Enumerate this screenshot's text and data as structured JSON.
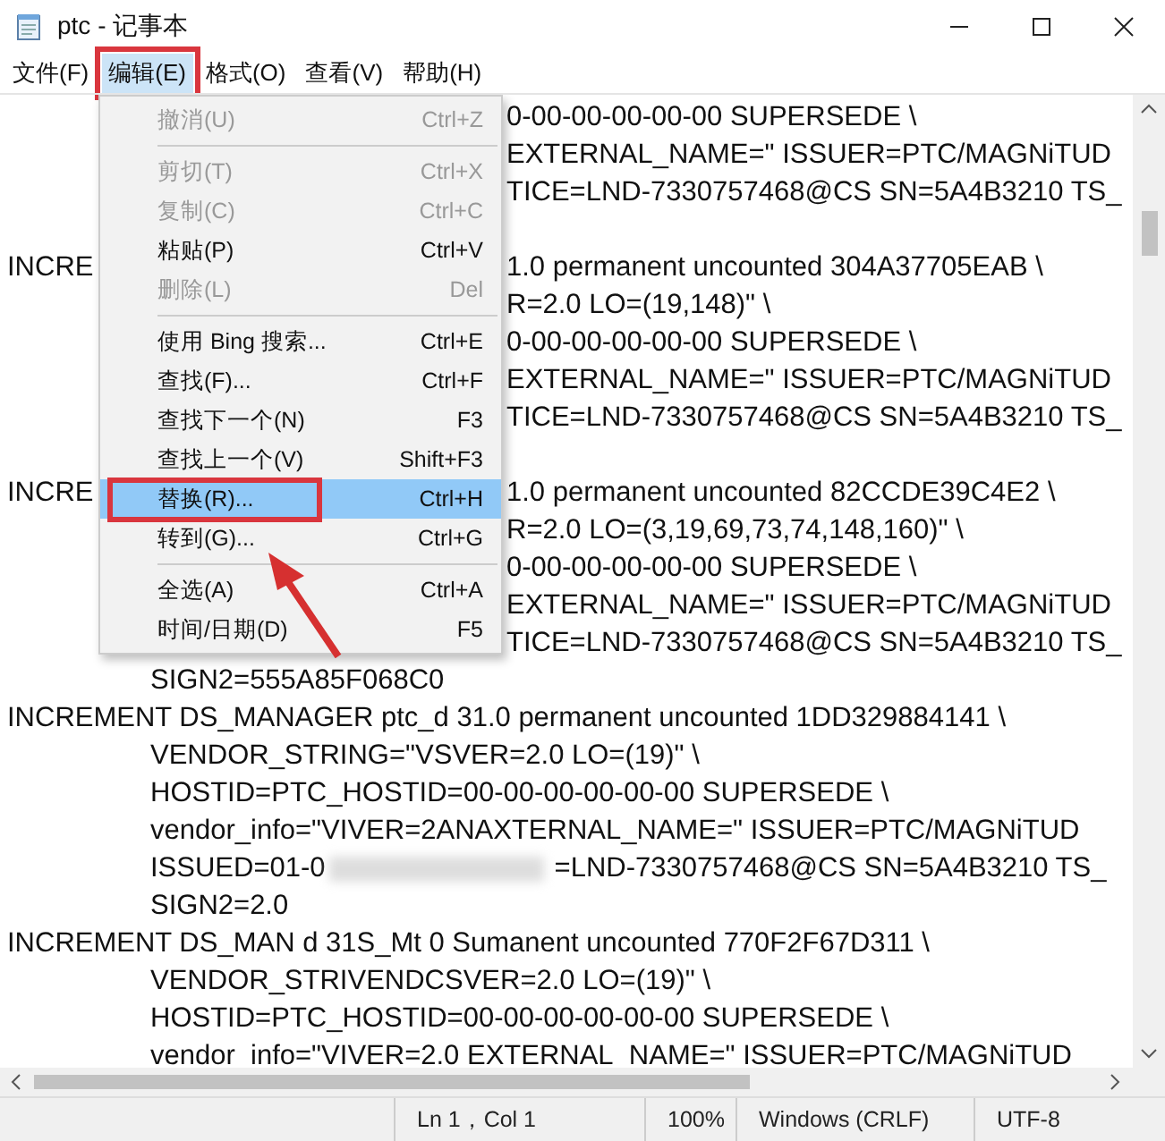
{
  "window": {
    "title": "ptc - 记事本"
  },
  "menubar": [
    {
      "label": "文件(F)",
      "selected": false,
      "highlighted": false
    },
    {
      "label": "编辑(E)",
      "selected": true,
      "highlighted": true
    },
    {
      "label": "格式(O)",
      "selected": false,
      "highlighted": false
    },
    {
      "label": "查看(V)",
      "selected": false,
      "highlighted": false
    },
    {
      "label": "帮助(H)",
      "selected": false,
      "highlighted": false
    }
  ],
  "lines": [
    {
      "kind": "cont",
      "tail": "0-00-00-00-00-00 SUPERSEDE \\"
    },
    {
      "kind": "cont",
      "tail": "EXTERNAL_NAME=\" ISSUER=PTC/MAGNiTUD"
    },
    {
      "kind": "cont",
      "tail": "TICE=LND-7330757468@CS SN=5A4B3210 TS_"
    },
    {
      "kind": "blank"
    },
    {
      "kind": "head",
      "lead": "INCRE",
      "tail": "1.0 permanent uncounted 304A37705EAB \\"
    },
    {
      "kind": "cont",
      "tail": "R=2.0 LO=(19,148)\" \\"
    },
    {
      "kind": "cont",
      "tail": "0-00-00-00-00-00 SUPERSEDE \\"
    },
    {
      "kind": "cont",
      "tail": "EXTERNAL_NAME=\" ISSUER=PTC/MAGNiTUD"
    },
    {
      "kind": "cont",
      "tail": "TICE=LND-7330757468@CS SN=5A4B3210 TS_"
    },
    {
      "kind": "blank"
    },
    {
      "kind": "head",
      "lead": "INCRE",
      "tail": "1.0 permanent uncounted 82CCDE39C4E2 \\"
    },
    {
      "kind": "cont",
      "tail": "R=2.0 LO=(3,19,69,73,74,148,160)\" \\"
    },
    {
      "kind": "cont",
      "tail": "0-00-00-00-00-00 SUPERSEDE \\"
    },
    {
      "kind": "cont",
      "tail": "EXTERNAL_NAME=\" ISSUER=PTC/MAGNiTUD"
    },
    {
      "kind": "cont",
      "tail": "TICE=LND-7330757468@CS SN=5A4B3210 TS_"
    },
    {
      "kind": "cont",
      "text": "SIGN2=555A85F068C0"
    },
    {
      "kind": "head",
      "text": "INCREMENT DS_MANAGER ptc_d 31.0 permanent uncounted 1DD329884141 \\"
    },
    {
      "kind": "cont",
      "text": "VENDOR_STRING=\"VSVER=2.0 LO=(19)\" \\"
    },
    {
      "kind": "cont",
      "text": "HOSTID=PTC_HOSTID=00-00-00-00-00-00 SUPERSEDE \\"
    },
    {
      "kind": "cont",
      "text": "vendor_info=\"VIVER=2ANAXTERNAL_NAME=\" ISSUER=PTC/MAGNiTUD"
    },
    {
      "kind": "cont",
      "text": "ISSUED=01-0",
      "smudged": true,
      "after": "=LND-7330757468@CS SN=5A4B3210 TS_"
    },
    {
      "kind": "cont",
      "text": "SIGN2=2.0"
    },
    {
      "kind": "head",
      "text": "INCREMENT DS_MAN d 31S_Mt 0 Sumanent uncounted 770F2F67D311 \\"
    },
    {
      "kind": "cont",
      "text": "VENDOR_STRIVENDCSVER=2.0 LO=(19)\" \\"
    },
    {
      "kind": "cont",
      "text": "HOSTID=PTC_HOSTID=00-00-00-00-00-00 SUPERSEDE \\"
    },
    {
      "kind": "cont",
      "text": "vendor_info=\"VIVER=2.0 EXTERNAL_NAME=\" ISSUER=PTC/MAGNiTUD"
    }
  ],
  "edit_menu": [
    {
      "kind": "item",
      "label": "撤消(U)",
      "shortcut": "Ctrl+Z",
      "disabled": true,
      "selected": false,
      "highlighted": false
    },
    {
      "kind": "separator"
    },
    {
      "kind": "item",
      "label": "剪切(T)",
      "shortcut": "Ctrl+X",
      "disabled": true,
      "selected": false,
      "highlighted": false
    },
    {
      "kind": "item",
      "label": "复制(C)",
      "shortcut": "Ctrl+C",
      "disabled": true,
      "selected": false,
      "highlighted": false
    },
    {
      "kind": "item",
      "label": "粘贴(P)",
      "shortcut": "Ctrl+V",
      "disabled": false,
      "selected": false,
      "highlighted": false
    },
    {
      "kind": "item",
      "label": "删除(L)",
      "shortcut": "Del",
      "disabled": true,
      "selected": false,
      "highlighted": false
    },
    {
      "kind": "separator"
    },
    {
      "kind": "item",
      "label": "使用 Bing 搜索...",
      "shortcut": "Ctrl+E",
      "disabled": false,
      "selected": false,
      "highlighted": false
    },
    {
      "kind": "item",
      "label": "查找(F)...",
      "shortcut": "Ctrl+F",
      "disabled": false,
      "selected": false,
      "highlighted": false
    },
    {
      "kind": "item",
      "label": "查找下一个(N)",
      "shortcut": "F3",
      "disabled": false,
      "selected": false,
      "highlighted": false
    },
    {
      "kind": "item",
      "label": "查找上一个(V)",
      "shortcut": "Shift+F3",
      "disabled": false,
      "selected": false,
      "highlighted": false
    },
    {
      "kind": "item",
      "label": "替换(R)...",
      "shortcut": "Ctrl+H",
      "disabled": false,
      "selected": true,
      "highlighted": true
    },
    {
      "kind": "item",
      "label": "转到(G)...",
      "shortcut": "Ctrl+G",
      "disabled": false,
      "selected": false,
      "highlighted": false
    },
    {
      "kind": "separator"
    },
    {
      "kind": "item",
      "label": "全选(A)",
      "shortcut": "Ctrl+A",
      "disabled": false,
      "selected": false,
      "highlighted": false
    },
    {
      "kind": "item",
      "label": "时间/日期(D)",
      "shortcut": "F5",
      "disabled": false,
      "selected": false,
      "highlighted": false
    }
  ],
  "status_bar": [
    "Ln 1，Col 1",
    "100%",
    "Windows (CRLF)",
    "UTF-8"
  ]
}
